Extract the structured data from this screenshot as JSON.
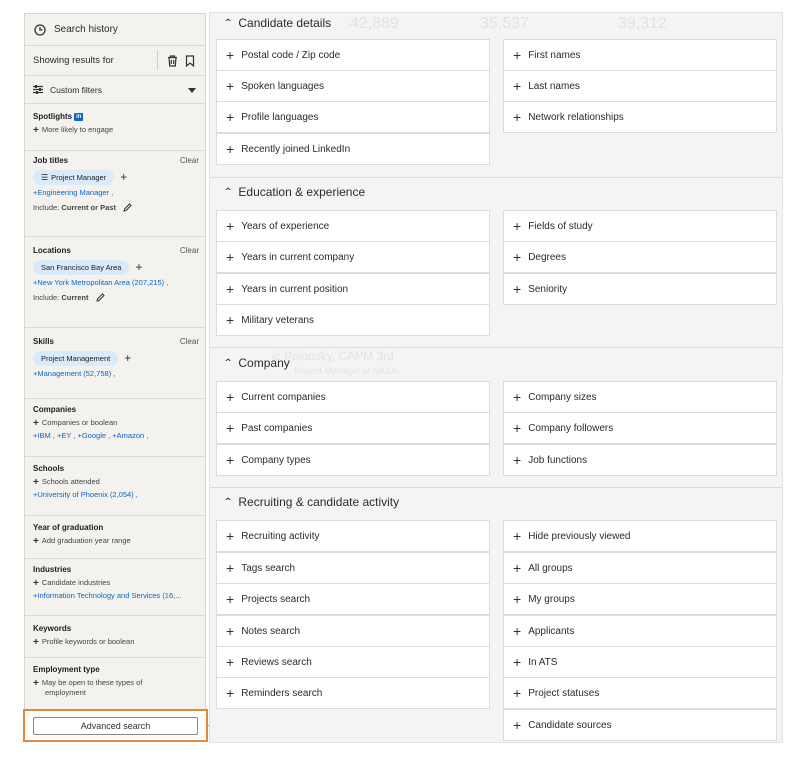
{
  "left_panel": {
    "search_history": "Search history",
    "showing_results_for": "Showing results for",
    "custom_filters": "Custom filters",
    "spotlights": {
      "title": "Spotlights",
      "badge": "in",
      "item": "More likely to engage"
    },
    "job_titles": {
      "title": "Job titles",
      "clear": "Clear",
      "pill": "Project Manager",
      "link": "+Engineering Manager ,",
      "include_label": "Include:",
      "include_value": "Current or Past"
    },
    "locations": {
      "title": "Locations",
      "clear": "Clear",
      "pill": "San Francisco Bay Area",
      "link": "+New York Metropolitan Area (207,215) ,",
      "include_label": "Include:",
      "include_value": "Current"
    },
    "skills": {
      "title": "Skills",
      "clear": "Clear",
      "pill": "Project Management",
      "link": "+Management (52,758) ,"
    },
    "companies": {
      "title": "Companies",
      "item": "Companies or boolean",
      "link": "+IBM , +EY , +Google , +Amazon ,"
    },
    "schools": {
      "title": "Schools",
      "item": "Schools attended",
      "link": "+University of Phoenix (2,054) ,"
    },
    "year_of_graduation": {
      "title": "Year of graduation",
      "item": "Add graduation year range"
    },
    "industries": {
      "title": "Industries",
      "item": "Candidate industries",
      "link": "+Information Technology and Services (16,..."
    },
    "keywords": {
      "title": "Keywords",
      "item": "Profile keywords or boolean"
    },
    "employment_type": {
      "title": "Employment type",
      "item_line1": "May be open to these types of",
      "item_line2": "employment"
    },
    "advanced_search": "Advanced search"
  },
  "background_numbers": [
    "42,889",
    "35,537",
    "39,312"
  ],
  "background_fragments": {
    "name": "ic Palonsky, CAPM",
    "degree": "3rd",
    "role": "Project Manager at NASA"
  },
  "groups": {
    "candidate_details": {
      "title": "Candidate details",
      "left": [
        "Postal code / Zip code",
        "Spoken languages",
        "Profile languages",
        "Recently joined LinkedIn"
      ],
      "right": [
        "First names",
        "Last names",
        "Network relationships"
      ]
    },
    "education": {
      "title": "Education & experience",
      "left": [
        "Years of experience",
        "Years in current company",
        "Years in current position",
        "Military veterans"
      ],
      "right": [
        "Fields of study",
        "Degrees",
        "Seniority"
      ]
    },
    "company": {
      "title": "Company",
      "left": [
        "Current companies",
        "Past companies",
        "Company types"
      ],
      "right": [
        "Company sizes",
        "Company followers",
        "Job functions"
      ]
    },
    "recruiting": {
      "title": "Recruiting & candidate activity",
      "left": [
        "Recruiting activity",
        "Tags search",
        "Projects search",
        "Notes search",
        "Reviews search",
        "Reminders search"
      ],
      "right": [
        "Hide previously viewed",
        "All groups",
        "My groups",
        "Applicants",
        "In ATS",
        "Project statuses",
        "Candidate sources"
      ]
    }
  },
  "colors": {
    "accent": "#e0893a",
    "link": "#0a66c2",
    "pill_bg": "#d9ebfa"
  },
  "icons": [
    "clock-icon",
    "trash-icon",
    "bookmark-icon",
    "sliders-icon",
    "caret-down-icon",
    "plus-icon",
    "pencil-icon",
    "chevron-up-icon"
  ]
}
